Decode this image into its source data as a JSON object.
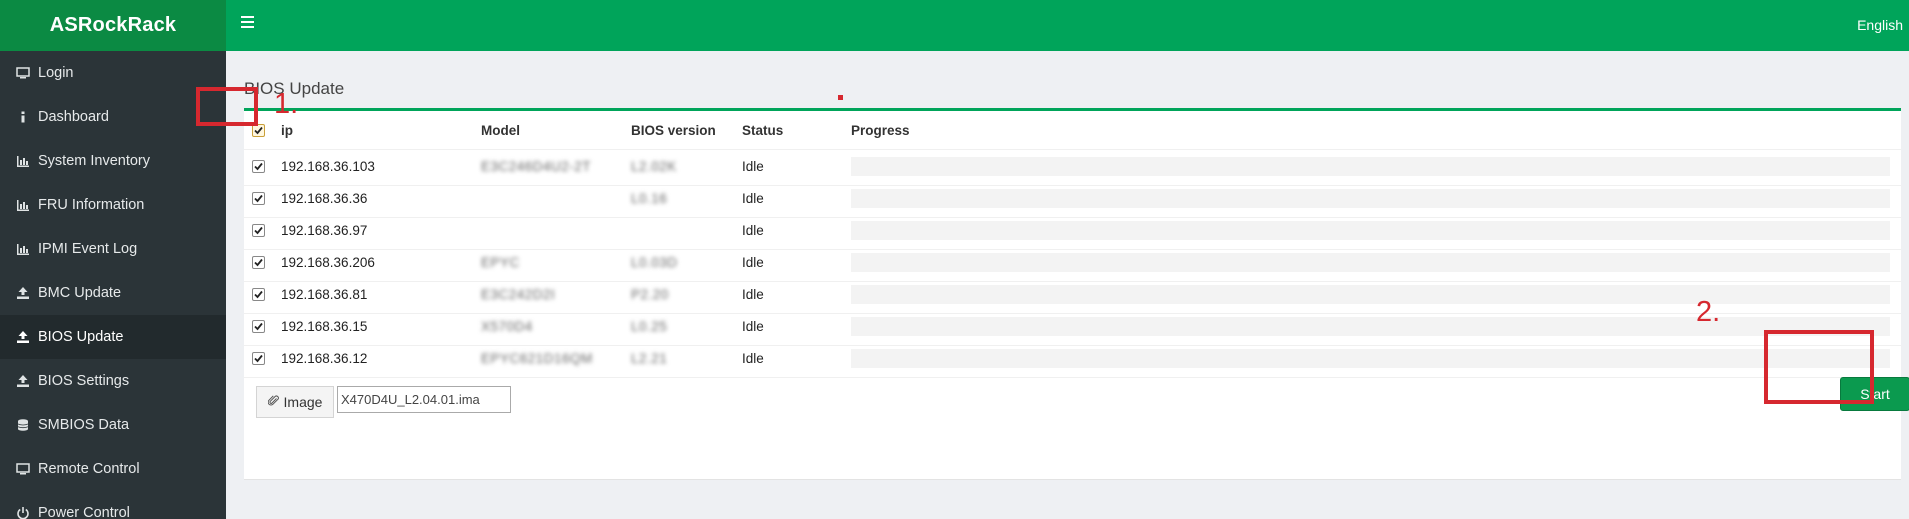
{
  "brand": "ASRockRack",
  "topbar": {
    "language": "English"
  },
  "sidebar": {
    "items": [
      {
        "label": "Login",
        "icon": "monitor-icon"
      },
      {
        "label": "Dashboard",
        "icon": "info-icon"
      },
      {
        "label": "System Inventory",
        "icon": "bar-chart-icon"
      },
      {
        "label": "FRU Information",
        "icon": "bar-chart-icon"
      },
      {
        "label": "IPMI Event Log",
        "icon": "bar-chart-icon"
      },
      {
        "label": "BMC Update",
        "icon": "upload-icon"
      },
      {
        "label": "BIOS Update",
        "icon": "upload-icon",
        "active": true
      },
      {
        "label": "BIOS Settings",
        "icon": "upload-icon"
      },
      {
        "label": "SMBIOS Data",
        "icon": "database-icon"
      },
      {
        "label": "Remote Control",
        "icon": "monitor-icon"
      },
      {
        "label": "Power Control",
        "icon": "power-icon"
      }
    ]
  },
  "main": {
    "title": "BIOS Update",
    "table": {
      "columns": [
        "ip",
        "Model",
        "BIOS version",
        "Status",
        "Progress"
      ],
      "select_all_checked": true,
      "rows": [
        {
          "checked": true,
          "ip": "192.168.36.103",
          "model": "E3C246D4U2-2T",
          "bios": "L2.02K",
          "status": "Idle",
          "progress": 0
        },
        {
          "checked": true,
          "ip": "192.168.36.36",
          "model": "",
          "bios": "L0.16",
          "status": "Idle",
          "progress": 0
        },
        {
          "checked": true,
          "ip": "192.168.36.97",
          "model": "",
          "bios": "",
          "status": "Idle",
          "progress": 0
        },
        {
          "checked": true,
          "ip": "192.168.36.206",
          "model": "EPYC",
          "bios": "L0.03D",
          "status": "Idle",
          "progress": 0
        },
        {
          "checked": true,
          "ip": "192.168.36.81",
          "model": "E3C242D2I",
          "bios": "P2.20",
          "status": "Idle",
          "progress": 0
        },
        {
          "checked": true,
          "ip": "192.168.36.15",
          "model": "X570D4",
          "bios": "L0.25",
          "status": "Idle",
          "progress": 0
        },
        {
          "checked": true,
          "ip": "192.168.36.12",
          "model": "EPYC621D16QM",
          "bios": "L2.21",
          "status": "Idle",
          "progress": 0
        }
      ]
    },
    "image_button_label": "Image",
    "image_file_value": "X470D4U_L2.04.01.ima",
    "start_label": "Start"
  },
  "annotations": {
    "label_1": "1.",
    "label_2": "2."
  },
  "colors": {
    "accent": "#00a45a",
    "brand_bar": "#0b8a43",
    "sidebar": "#2b3438",
    "annotation": "#d6282f"
  }
}
